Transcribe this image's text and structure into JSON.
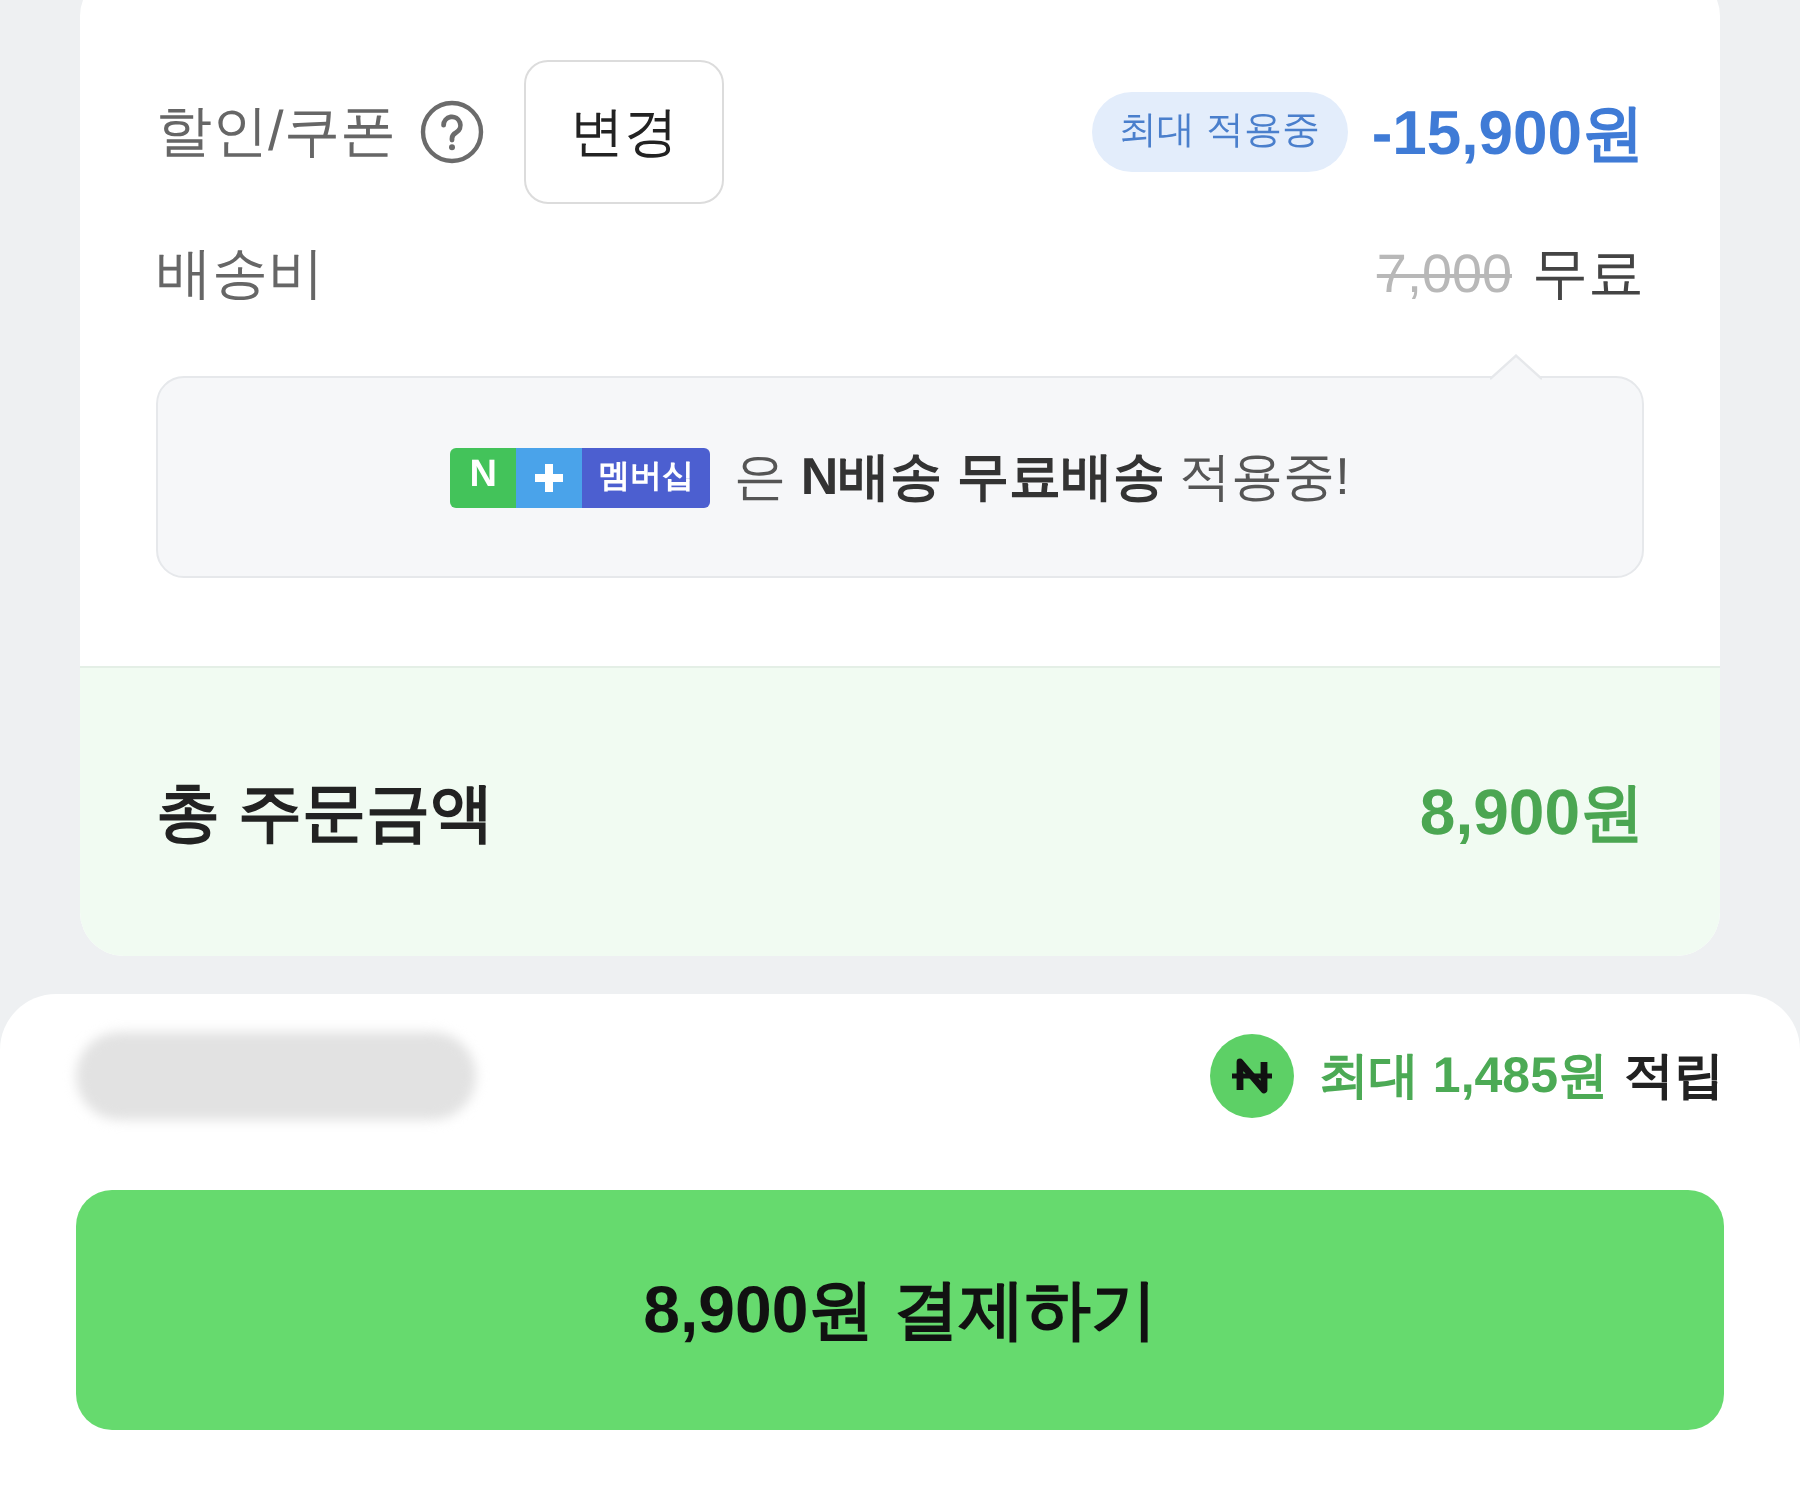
{
  "discount": {
    "label": "할인/쿠폰",
    "change_button": "변경",
    "badge": "최대 적용중",
    "amount": "-15,900원"
  },
  "shipping": {
    "label": "배송비",
    "original_price": "7,000",
    "price": "무료"
  },
  "notice": {
    "logo_letter": "N",
    "logo_label": "멤버십",
    "text": "은 **N배송 무료배송** 적용중!"
  },
  "total": {
    "label": "총 주문금액",
    "amount": "8,900원"
  },
  "footer": {
    "points_text": "최대 1,485원",
    "points_suffix": "적립",
    "pay_button": "8,900원 결제하기"
  }
}
